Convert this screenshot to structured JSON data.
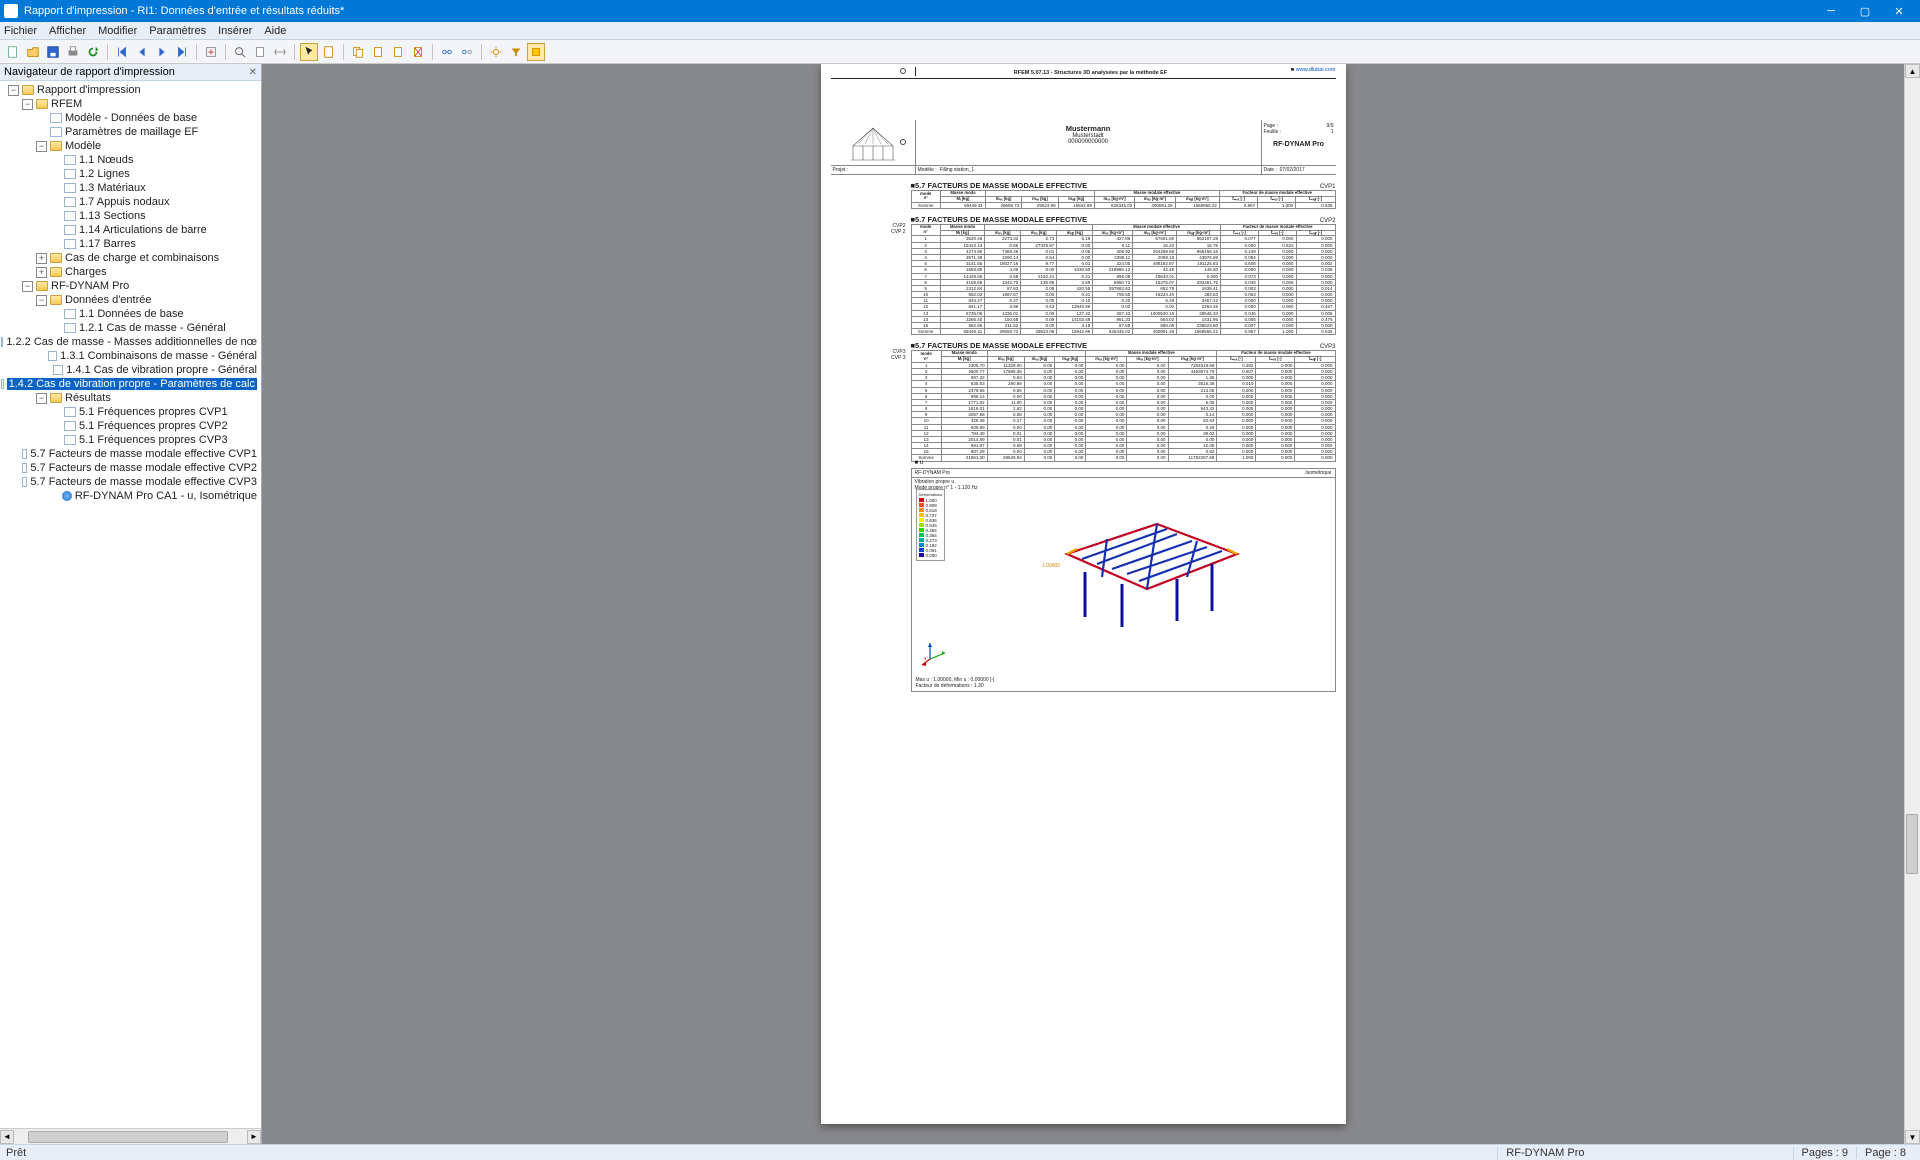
{
  "window": {
    "title": "Rapport d'impression - RI1: Données d'entrée et résultats réduits*"
  },
  "menu": [
    "Fichier",
    "Afficher",
    "Modifier",
    "Paramètres",
    "Insérer",
    "Aide"
  ],
  "nav": {
    "title": "Navigateur de rapport d'impression"
  },
  "tree": [
    {
      "d": 0,
      "t": "tw-",
      "i": "folder",
      "l": "Rapport d'impression"
    },
    {
      "d": 1,
      "t": "tw-",
      "i": "folder",
      "l": "RFEM"
    },
    {
      "d": 2,
      "t": "",
      "i": "doc",
      "l": "Modèle - Données de base"
    },
    {
      "d": 2,
      "t": "",
      "i": "doc",
      "l": "Paramètres de maillage EF"
    },
    {
      "d": 2,
      "t": "tw-",
      "i": "folder",
      "l": "Modèle"
    },
    {
      "d": 3,
      "t": "",
      "i": "doc",
      "l": "1.1 Nœuds"
    },
    {
      "d": 3,
      "t": "",
      "i": "doc",
      "l": "1.2 Lignes"
    },
    {
      "d": 3,
      "t": "",
      "i": "doc",
      "l": "1.3 Matériaux"
    },
    {
      "d": 3,
      "t": "",
      "i": "doc",
      "l": "1.7 Appuis nodaux"
    },
    {
      "d": 3,
      "t": "",
      "i": "doc",
      "l": "1.13 Sections"
    },
    {
      "d": 3,
      "t": "",
      "i": "doc",
      "l": "1.14 Articulations de barre"
    },
    {
      "d": 3,
      "t": "",
      "i": "doc",
      "l": "1.17 Barres"
    },
    {
      "d": 2,
      "t": "tw+",
      "i": "folder",
      "l": "Cas de charge et combinaisons"
    },
    {
      "d": 2,
      "t": "tw+",
      "i": "folder",
      "l": "Charges"
    },
    {
      "d": 1,
      "t": "tw-",
      "i": "folder",
      "l": "RF-DYNAM Pro"
    },
    {
      "d": 2,
      "t": "tw-",
      "i": "folder",
      "l": "Données d'entrée"
    },
    {
      "d": 3,
      "t": "",
      "i": "doc",
      "l": "1.1 Données de base"
    },
    {
      "d": 3,
      "t": "",
      "i": "doc",
      "l": "1.2.1 Cas de masse - Général"
    },
    {
      "d": 3,
      "t": "",
      "i": "doc",
      "l": "1.2.2 Cas de masse - Masses additionnelles de nœ"
    },
    {
      "d": 3,
      "t": "",
      "i": "doc",
      "l": "1.3.1 Combinaisons de masse - Général"
    },
    {
      "d": 3,
      "t": "",
      "i": "doc",
      "l": "1.4.1 Cas de vibration propre - Général"
    },
    {
      "d": 3,
      "t": "",
      "i": "doc",
      "l": "1.4.2 Cas de vibration propre - Paramètres de calc",
      "sel": true
    },
    {
      "d": 2,
      "t": "tw-",
      "i": "folder",
      "l": "Résultats"
    },
    {
      "d": 3,
      "t": "",
      "i": "doc",
      "l": "5.1 Fréquences propres CVP1"
    },
    {
      "d": 3,
      "t": "",
      "i": "doc",
      "l": "5.1 Fréquences propres CVP2"
    },
    {
      "d": 3,
      "t": "",
      "i": "doc",
      "l": "5.1 Fréquences propres CVP3"
    },
    {
      "d": 3,
      "t": "",
      "i": "doc",
      "l": "5.7 Facteurs de masse modale effective CVP1"
    },
    {
      "d": 3,
      "t": "",
      "i": "doc",
      "l": "5.7 Facteurs de masse modale effective CVP2"
    },
    {
      "d": 3,
      "t": "",
      "i": "doc",
      "l": "5.7 Facteurs de masse modale effective CVP3"
    },
    {
      "d": 3,
      "t": "",
      "i": "globe",
      "l": "RF-DYNAM Pro CA1 -  u, Isométrique"
    }
  ],
  "page_header": {
    "software": "RFEM 5.07.13 - Structures 3D analysées par la méthode EF",
    "link": "www.dlubal.com"
  },
  "info": {
    "company": "Mustermann",
    "city": "Musterstadt",
    "code": "000000000000",
    "page_label": "Page :",
    "page": "9/9",
    "sheet_label": "Feuille :",
    "sheet": "1",
    "module": "RF-DYNAM Pro",
    "proj_label": "Projet :",
    "model_label": "Modèle :",
    "model": "Filling station_1",
    "date_label": "Date :",
    "date": "07/02/2017"
  },
  "sect": {
    "title": "5.7 FACTEURS DE MASSE MODALE EFFECTIVE",
    "cvp1": "CVP1",
    "cvp2": "CVP2",
    "cvp3": "CVP3",
    "note2": "CVP2\nCVP 2",
    "note3": "CVP3\nCVP 3"
  },
  "cols_top": [
    "mode",
    "Masse moda",
    "",
    "",
    "Masse modale effective",
    "",
    "",
    "",
    "Facteur de masse modale effective",
    "",
    ""
  ],
  "cols": [
    "n°",
    "Mᵢ [kg]",
    "mₑₓ [kg]",
    "mₑᵧ [kg]",
    "mₑ𝓏 [kg]",
    "mₑₓ [kg·m²]",
    "mₑᵧ [kg·m²]",
    "mₑ𝓏 [kg·m²]",
    "fₘₑₓ [-]",
    "fₘₑᵧ [-]",
    "fₘₑ𝓏 [-]"
  ],
  "t1_sum": [
    "Somme",
    "69449.31",
    "29658.73",
    "29623.99",
    "15842.99",
    "626345.02",
    "400091.26",
    "1569565.22",
    "0.967",
    "1.000",
    "0.535"
  ],
  "t2": [
    [
      "1",
      "3620.46",
      "2273.32",
      "2.73",
      "6.19",
      "427.86",
      "57651.80",
      "562107.28",
      "0.077",
      "0.000",
      "0.000"
    ],
    [
      "2",
      "15423.13",
      "0.56",
      "27329.97",
      "0.00",
      "0.11",
      "16.22",
      "16.76",
      "0.000",
      "0.922",
      "0.000"
    ],
    [
      "3",
      "4274.90",
      "7388.46",
      "0.01",
      "0.05",
      "308.92",
      "204288.69",
      "959156.16",
      "0.249",
      "0.000",
      "0.000"
    ],
    [
      "4",
      "3571.39",
      "1590.14",
      "0.54",
      "0.00",
      "2399.11",
      "2098.18",
      "43976.69",
      "0.054",
      "0.000",
      "0.000"
    ],
    [
      "5",
      "3141.55",
      "18027.16",
      "9.77",
      "0.01",
      "324.00",
      "498182.87",
      "191125.83",
      "0.608",
      "0.000",
      "0.002"
    ],
    [
      "6",
      "1593.80",
      "4.06",
      "0.00",
      "1030.50",
      "218986.12",
      "42.45",
      "146.50",
      "0.000",
      "0.000",
      "0.035"
    ],
    [
      "7",
      "14429.65",
      "0.58",
      "2152.21",
      "0.21",
      "895.08",
      "19633.01",
      "0.000",
      "0.073",
      "0.000",
      "0.000"
    ],
    [
      "8",
      "4158.65",
      "1342.70",
      "136.96",
      "3.59",
      "6960.72",
      "15375.07",
      "293461.76",
      "0.045",
      "0.005",
      "0.000"
    ],
    [
      "9",
      "1312.84",
      "87.63",
      "0.08",
      "420.55",
      "397883.63",
      "652.78",
      "1639.41",
      "0.003",
      "0.000",
      "0.014"
    ],
    [
      "10",
      "682.02",
      "1867.67",
      "0.00",
      "0.41",
      "795.55",
      "18224.40",
      "383.63",
      "0.063",
      "0.000",
      "0.000"
    ],
    [
      "11",
      "834.27",
      "0.27",
      "0.00",
      "0.10",
      "0.20",
      "6.29",
      "3457.22",
      "0.000",
      "0.000",
      "0.000"
    ],
    [
      "12",
      "841.17",
      "3.96",
      "0.63",
      "13840.86",
      "0.02",
      "0.02",
      "2263.45",
      "0.000",
      "0.000",
      "0.467"
    ],
    [
      "13",
      "5735.06",
      "1336.01",
      "0.00",
      "137.42",
      "287.43",
      "1000520.15",
      "28546.34",
      "0.045",
      "0.000",
      "0.005"
    ],
    [
      "14",
      "3286.40",
      "150.58",
      "0.09",
      "14102.49",
      "961.33",
      "664.02",
      "1431.95",
      "0.005",
      "0.000",
      "0.476"
    ],
    [
      "15",
      "882.85",
      "211.52",
      "0.00",
      "3.18",
      "87.65",
      "589.05",
      "238523.60",
      "0.007",
      "0.000",
      "0.000"
    ],
    [
      "Somme",
      "69449.31",
      "29658.73",
      "29623.09",
      "15842.99",
      "626345.02",
      "400091.26",
      "1569565.22",
      "0.967",
      "1.000",
      "0.535"
    ]
  ],
  "t3": [
    [
      "1",
      "2305.70",
      "11329.00",
      "0.00",
      "0.00",
      "0.00",
      "0.00",
      "7254018.68",
      "0.382",
      "0.000",
      "0.000"
    ],
    [
      "2",
      "2600.77",
      "17985.38",
      "0.00",
      "0.00",
      "0.00",
      "0.00",
      "4463674.79",
      "0.607",
      "0.000",
      "0.000"
    ],
    [
      "3",
      "587.32",
      "0.63",
      "0.00",
      "0.00",
      "0.00",
      "0.00",
      "1.36",
      "0.000",
      "0.000",
      "0.000"
    ],
    [
      "4",
      "835.63",
      "290.89",
      "0.00",
      "0.00",
      "0.00",
      "0.00",
      "3516.39",
      "0.010",
      "0.000",
      "0.000"
    ],
    [
      "5",
      "2379.66",
      "0.06",
      "0.00",
      "0.00",
      "0.00",
      "0.00",
      "213.05",
      "0.000",
      "0.000",
      "0.000"
    ],
    [
      "6",
      "996.12",
      "0.00",
      "0.00",
      "0.00",
      "0.00",
      "0.00",
      "0.00",
      "0.000",
      "0.000",
      "0.000"
    ],
    [
      "7",
      "1771.02",
      "11.00",
      "0.00",
      "0.00",
      "0.00",
      "0.00",
      "6.05",
      "0.000",
      "0.000",
      "0.000"
    ],
    [
      "8",
      "1816.01",
      "2.62",
      "0.00",
      "0.00",
      "0.00",
      "0.00",
      "643.42",
      "0.000",
      "0.000",
      "0.000"
    ],
    [
      "9",
      "2057.58",
      "0.08",
      "0.00",
      "0.00",
      "0.00",
      "0.00",
      "0.14",
      "0.000",
      "0.000",
      "0.000"
    ],
    [
      "10",
      "326.35",
      "0.17",
      "0.00",
      "0.00",
      "0.00",
      "0.00",
      "82.63",
      "0.000",
      "0.000",
      "0.000"
    ],
    [
      "11",
      "505.89",
      "0.00",
      "0.00",
      "0.00",
      "0.00",
      "0.00",
      "0.29",
      "0.000",
      "0.000",
      "0.000"
    ],
    [
      "12",
      "784.49",
      "0.01",
      "0.00",
      "0.00",
      "0.00",
      "0.00",
      "39.02",
      "0.000",
      "0.000",
      "0.000"
    ],
    [
      "13",
      "2014.89",
      "0.01",
      "0.00",
      "0.00",
      "0.00",
      "0.00",
      "0.00",
      "0.000",
      "0.000",
      "0.000"
    ],
    [
      "14",
      "581.97",
      "0.08",
      "0.00",
      "0.00",
      "0.00",
      "0.00",
      "12.05",
      "0.000",
      "0.000",
      "0.000"
    ],
    [
      "15",
      "807.28",
      "0.00",
      "0.00",
      "0.00",
      "0.00",
      "0.00",
      "0.82",
      "0.000",
      "0.000",
      "0.000"
    ],
    [
      "Somme",
      "21961.30",
      "29629.92",
      "0.00",
      "0.00",
      "0.00",
      "0.00",
      "11762287.69",
      "1.000",
      "0.000",
      "0.000"
    ]
  ],
  "graphic": {
    "u": "u",
    "hl": "RF-DYNAM Pro",
    "hr": "Isométrique",
    "sub1": "Vibration propre u",
    "sub2": "Mode propre n° 1 - 1.120 Hz",
    "legend_title": "Déformations",
    "legend": [
      {
        "v": "1.000",
        "c": "#d2001c"
      },
      {
        "v": "0.909",
        "c": "#ef4e00"
      },
      {
        "v": "0.818",
        "c": "#f98f00"
      },
      {
        "v": "0.727",
        "c": "#fdc500"
      },
      {
        "v": "0.636",
        "c": "#eef200"
      },
      {
        "v": "0.545",
        "c": "#97e400"
      },
      {
        "v": "0.455",
        "c": "#2ed300"
      },
      {
        "v": "0.364",
        "c": "#00c05c"
      },
      {
        "v": "0.273",
        "c": "#00a8a8"
      },
      {
        "v": "0.182",
        "c": "#0083d6"
      },
      {
        "v": "0.091",
        "c": "#0040e0"
      },
      {
        "v": "0.000",
        "c": "#2000a8"
      }
    ],
    "ann": "1.00000",
    "cap1": "Max u : 1.00000, Min u : 0.00000 [-]",
    "cap2": "Facteur de déformations : 1.30"
  },
  "status": {
    "ready": "Prêt",
    "module": "RF-DYNAM Pro",
    "pages": "Pages : 9",
    "page": "Page : 8"
  }
}
